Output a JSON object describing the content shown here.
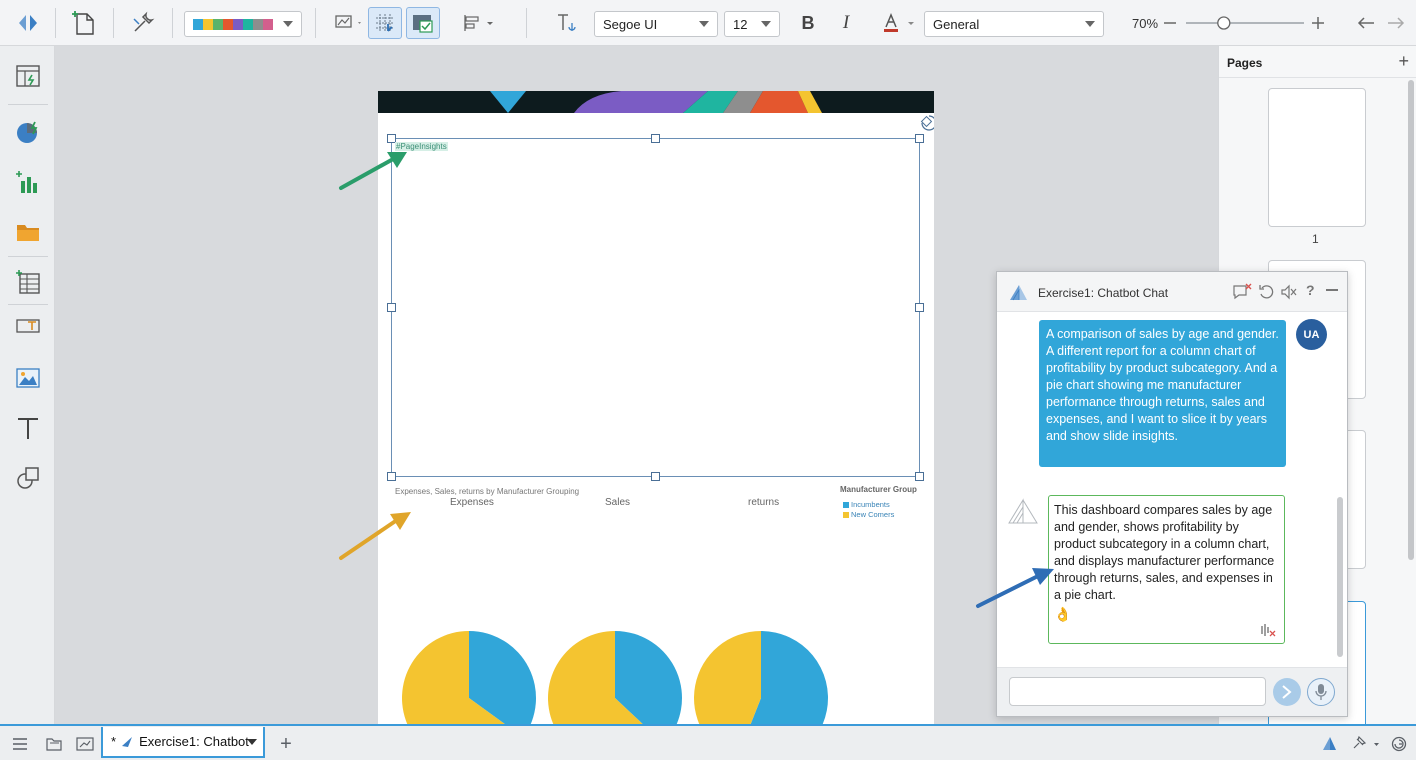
{
  "toolbar": {
    "palette_colors": [
      "#31a6d9",
      "#f4c430",
      "#5bb36b",
      "#e4572e",
      "#7b5cc4",
      "#1fb5a0",
      "#8e8e8e",
      "#d35f8d"
    ],
    "font_family": "Segoe UI",
    "font_size": "12",
    "bold_label": "B",
    "italic_label": "I",
    "font_color": "#c0392b",
    "number_format": "General",
    "zoom": "70%",
    "zoom_fraction": 0.3
  },
  "left_rail": {
    "icons": [
      "dashboard-icon",
      "chart-wizard-icon",
      "add-chart-icon",
      "folder-icon",
      "add-table-icon",
      "text-frame-icon",
      "image-icon",
      "text-icon",
      "shapes-icon"
    ]
  },
  "page": {
    "insights_tag": "#PageInsights",
    "chart_title": "Expenses, Sales, returns by Manufacturer Grouping",
    "pie_labels": [
      "Expenses",
      "Sales",
      "returns"
    ],
    "legend_title": "Manufacturer Group",
    "legend_items": [
      {
        "label": "Incumbents",
        "color": "#31a6d9"
      },
      {
        "label": "New Comers",
        "color": "#f4c430"
      }
    ]
  },
  "chart_data": {
    "type": "pie",
    "title": "Expenses, Sales, returns by Manufacturer Grouping",
    "legend_title": "Manufacturer Group",
    "legend_position": "top-right",
    "categories": [
      "Incumbents",
      "New Comers"
    ],
    "pies": [
      {
        "name": "Expenses",
        "values": [
          35,
          65
        ]
      },
      {
        "name": "Sales",
        "values": [
          37,
          63
        ]
      },
      {
        "name": "returns",
        "values": [
          56,
          44
        ]
      }
    ],
    "colors": [
      "#31a6d9",
      "#f4c430"
    ]
  },
  "pages_panel": {
    "title": "Pages",
    "add_label": "+",
    "first_page_number": "1"
  },
  "chat": {
    "title": "Exercise1: Chatbot Chat",
    "user_avatar": "UA",
    "user_message": "A comparison of sales by age and gender. A different report for a column chart of profitability by product subcategory. And a pie chart showing me manufacturer performance through returns, sales and expenses, and I want to slice it by years and show slide insights.",
    "bot_message": "This dashboard compares sales by age and gender, shows profitability by product subcategory in a column chart, and displays manufacturer performance through returns, sales, and expenses in a pie chart.",
    "bot_emoji": "👌",
    "input_value": "",
    "input_placeholder": ""
  },
  "bottom_bar": {
    "tab_modified": "*",
    "tab_label": "Exercise1: Chatbot",
    "add_tab_label": "+"
  }
}
